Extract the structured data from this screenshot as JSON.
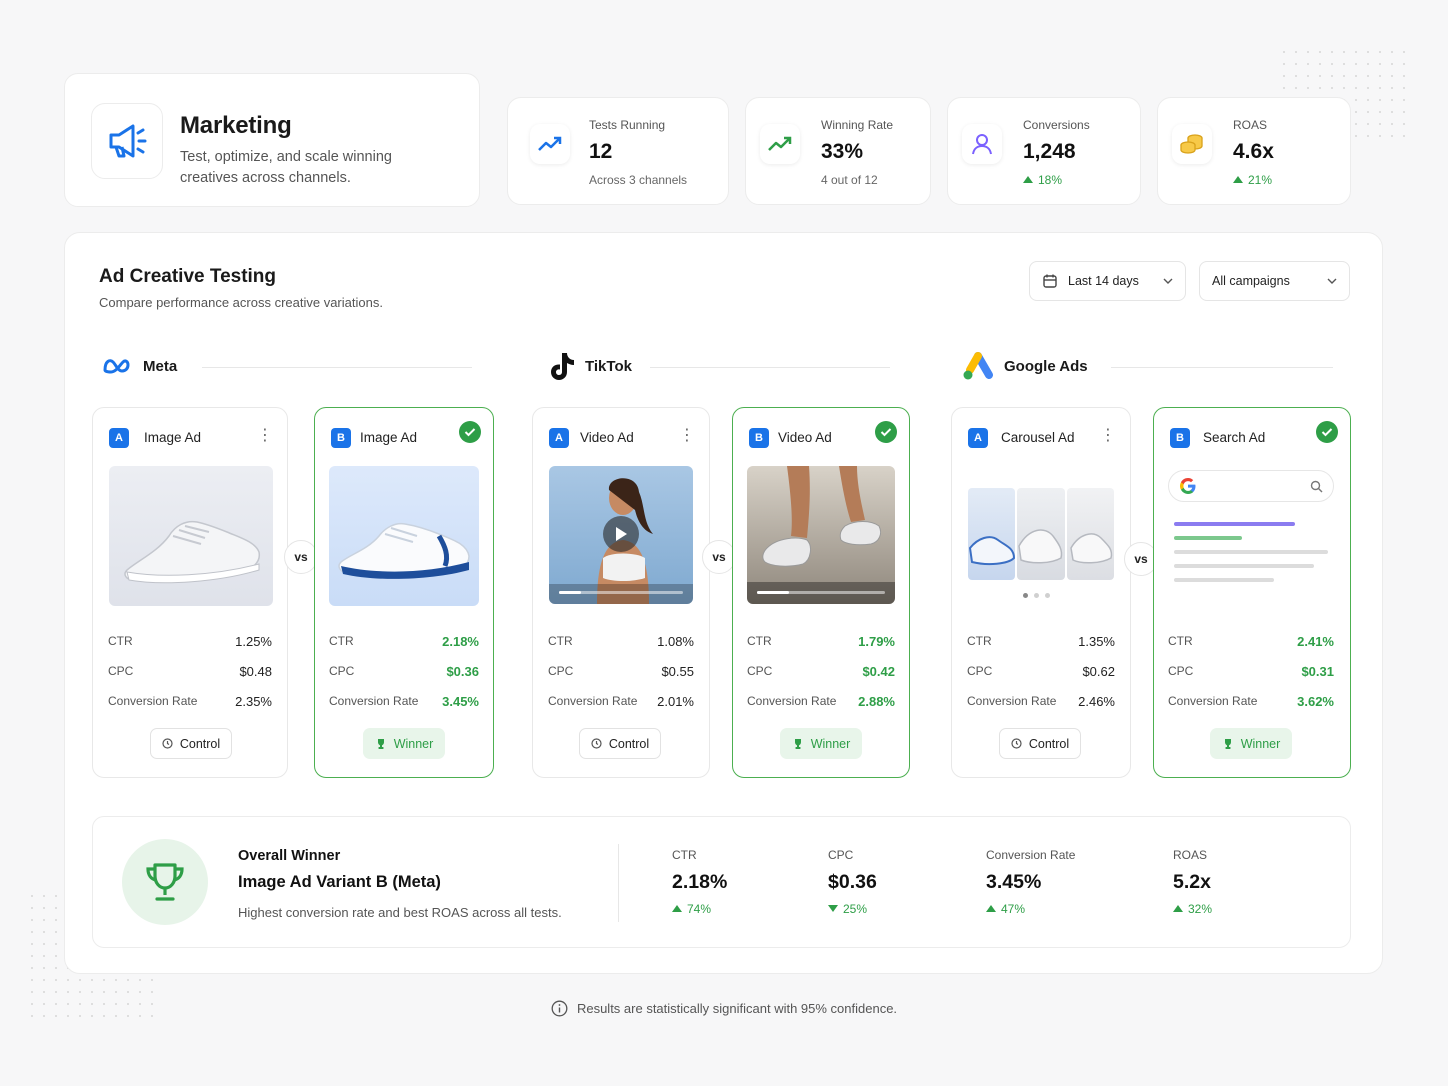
{
  "header": {
    "title": "Marketing",
    "subtitle": "Test, optimize, and scale winning creatives across channels."
  },
  "stats": [
    {
      "label": "Tests Running",
      "value": "12",
      "sub": "Across 3 channels",
      "icon": "trend-up-icon"
    },
    {
      "label": "Winning Rate",
      "value": "33%",
      "sub": "4 out of 12",
      "icon": "trend-up-icon"
    },
    {
      "label": "Conversions",
      "value": "1,248",
      "change": "18%",
      "icon": "user-icon"
    },
    {
      "label": "ROAS",
      "value": "4.6x",
      "change": "21%",
      "icon": "coins-icon"
    }
  ],
  "panel": {
    "title": "Ad Creative Testing",
    "subtitle": "Compare performance across creative variations.",
    "date_filter": "Last 14 days",
    "campaign_filter": "All campaigns"
  },
  "channels": [
    {
      "name": "Meta",
      "variants": [
        {
          "badge": "A",
          "title": "Image Ad",
          "ctr": "1.25%",
          "cpc": "$0.48",
          "conv": "2.35%",
          "status": "Control"
        },
        {
          "badge": "B",
          "title": "Image Ad",
          "ctr": "2.18%",
          "cpc": "$0.36",
          "conv": "3.45%",
          "status": "Winner"
        }
      ]
    },
    {
      "name": "TikTok",
      "variants": [
        {
          "badge": "A",
          "title": "Video Ad",
          "ctr": "1.08%",
          "cpc": "$0.55",
          "conv": "2.01%",
          "status": "Control"
        },
        {
          "badge": "B",
          "title": "Video Ad",
          "ctr": "1.79%",
          "cpc": "$0.42",
          "conv": "2.88%",
          "status": "Winner"
        }
      ]
    },
    {
      "name": "Google Ads",
      "variants": [
        {
          "badge": "A",
          "title": "Carousel Ad",
          "ctr": "1.35%",
          "cpc": "$0.62",
          "conv": "2.46%",
          "status": "Control"
        },
        {
          "badge": "B",
          "title": "Search Ad",
          "ctr": "2.41%",
          "cpc": "$0.31",
          "conv": "3.62%",
          "status": "Winner"
        }
      ]
    }
  ],
  "metric_labels": {
    "ctr": "CTR",
    "cpc": "CPC",
    "conv": "Conversion Rate"
  },
  "vs_label": "vs",
  "overall": {
    "label": "Overall Winner",
    "name": "Image Ad Variant B (Meta)",
    "desc": "Highest conversion rate and best ROAS across all tests.",
    "metrics": [
      {
        "label": "CTR",
        "value": "2.18%",
        "change": "74%",
        "direction": "up"
      },
      {
        "label": "CPC",
        "value": "$0.36",
        "change": "25%",
        "direction": "down"
      },
      {
        "label": "Conversion Rate",
        "value": "3.45%",
        "change": "47%",
        "direction": "up"
      },
      {
        "label": "ROAS",
        "value": "5.2x",
        "change": "32%",
        "direction": "up"
      }
    ]
  },
  "footnote": "Results are statistically significant with 95% confidence.",
  "colors": {
    "accent": "#1a73e8",
    "green": "#2e9e47",
    "green_bg": "#e8f5ea"
  }
}
